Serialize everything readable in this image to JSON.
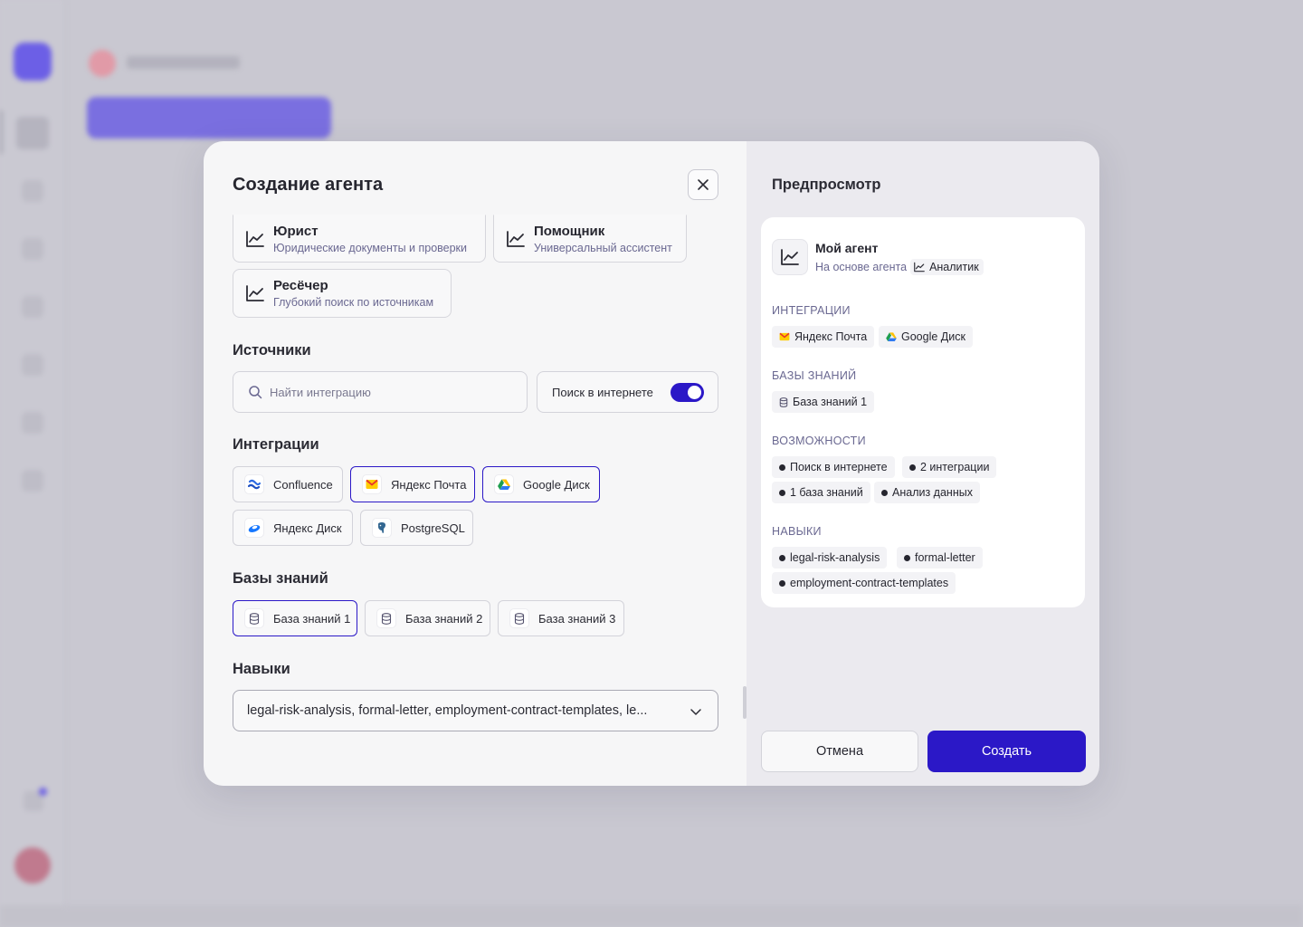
{
  "modal": {
    "title": "Создание агента",
    "agents": [
      {
        "name": "Юрист",
        "desc": "Юридические документы и проверки"
      },
      {
        "name": "Помощник",
        "desc": "Универсальный ассистент"
      },
      {
        "name": "Ресёчер",
        "desc": "Глубокий поиск по источникам"
      }
    ],
    "sources": {
      "title": "Источники",
      "search_placeholder": "Найти интеграцию",
      "web_search_label": "Поиск в интернете",
      "web_search_enabled": true
    },
    "integrations": {
      "title": "Интеграции",
      "items": [
        {
          "label": "Confluence",
          "selected": false
        },
        {
          "label": "Яндекс Почта",
          "selected": true
        },
        {
          "label": "Google Диск",
          "selected": true
        },
        {
          "label": "Яндекс Диск",
          "selected": false
        },
        {
          "label": "PostgreSQL",
          "selected": false
        }
      ]
    },
    "knowledge": {
      "title": "Базы знаний",
      "items": [
        {
          "label": "База знаний 1",
          "selected": true
        },
        {
          "label": "База знаний 2",
          "selected": false
        },
        {
          "label": "База знаний 3",
          "selected": false
        }
      ]
    },
    "skills": {
      "title": "Навыки",
      "value": "legal-risk-analysis, formal-letter, employment-contract-templates, le..."
    }
  },
  "preview": {
    "title": "Предпросмотр",
    "agent_name": "Мой агент",
    "based_on_label": "На основе агента",
    "based_on_agent": "Аналитик",
    "integrations_label": "ИНТЕГРАЦИИ",
    "integrations": [
      "Яндекс Почта",
      "Google Диск"
    ],
    "knowledge_label": "БАЗЫ ЗНАНИЙ",
    "knowledge": [
      "База знаний 1"
    ],
    "capabilities_label": "ВОЗМОЖНОСТИ",
    "capabilities": [
      "Поиск в интернете",
      "2 интеграции",
      "1 база знаний",
      "Анализ данных"
    ],
    "skills_label": "НАВЫКИ",
    "skills": [
      "legal-risk-analysis",
      "formal-letter",
      "employment-contract-templates"
    ]
  },
  "actions": {
    "cancel": "Отмена",
    "create": "Создать"
  },
  "colors": {
    "accent": "#2b18c7",
    "muted_text": "#6a6891",
    "overlay": "#c9c8d1"
  }
}
